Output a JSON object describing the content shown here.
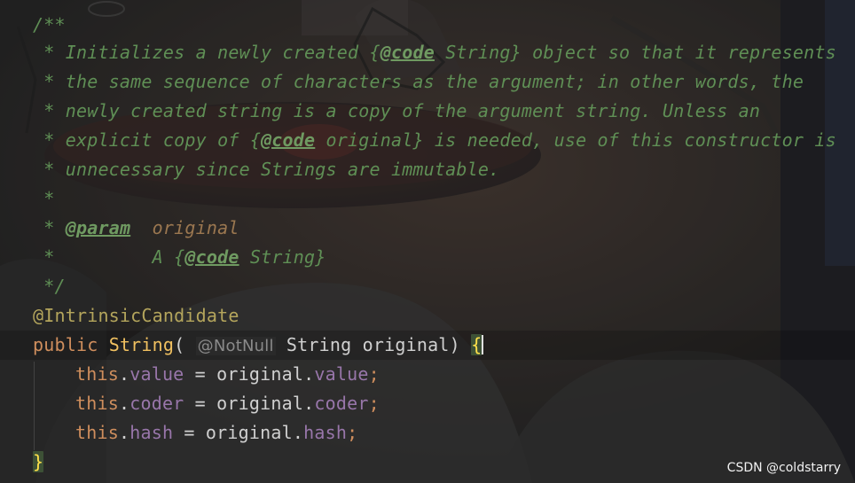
{
  "editor": {
    "comment": {
      "open": "/**",
      "l1_prefix": " * ",
      "l1_a": "Initializes a newly created {",
      "l1_tag": "@code",
      "l1_b": " String} object so that it represents",
      "l2": " * the same sequence of characters as the argument; in other words, the",
      "l3": " * newly created string is a copy of the argument string. Unless an",
      "l4_a": " * explicit copy of {",
      "l4_tag": "@code",
      "l4_b": " original} is needed, use of this constructor is",
      "l5": " * unnecessary since Strings are immutable.",
      "l6": " *",
      "l7_prefix": " * ",
      "l7_tag": "@param",
      "l7_gap": "  ",
      "l7_name": "original",
      "l8_prefix": " *         A {",
      "l8_tag": "@code",
      "l8_b": " String}",
      "close": " */"
    },
    "annotation": "@IntrinsicCandidate",
    "signature": {
      "modifier": "public",
      "name": "String",
      "paren_open": "(",
      "hint": "@NotNull",
      "param_type": "String",
      "param_name": "original",
      "paren_close": ")",
      "brace": "{"
    },
    "body": [
      {
        "kw": "this",
        "field": "value",
        "rhs_obj": "original",
        "rhs_field": "value"
      },
      {
        "kw": "this",
        "field": "coder",
        "rhs_obj": "original",
        "rhs_field": "coder"
      },
      {
        "kw": "this",
        "field": "hash",
        "rhs_obj": "original",
        "rhs_field": "hash"
      }
    ],
    "closing_brace": "}"
  },
  "watermark": "CSDN @coldstarry",
  "colors": {
    "doc_comment": "#5f8f55",
    "keyword": "#cf8e5d",
    "annotation": "#b4a55c",
    "field": "#9876aa",
    "method_name": "#f0c060",
    "brace_highlight": "#ffe14a"
  }
}
